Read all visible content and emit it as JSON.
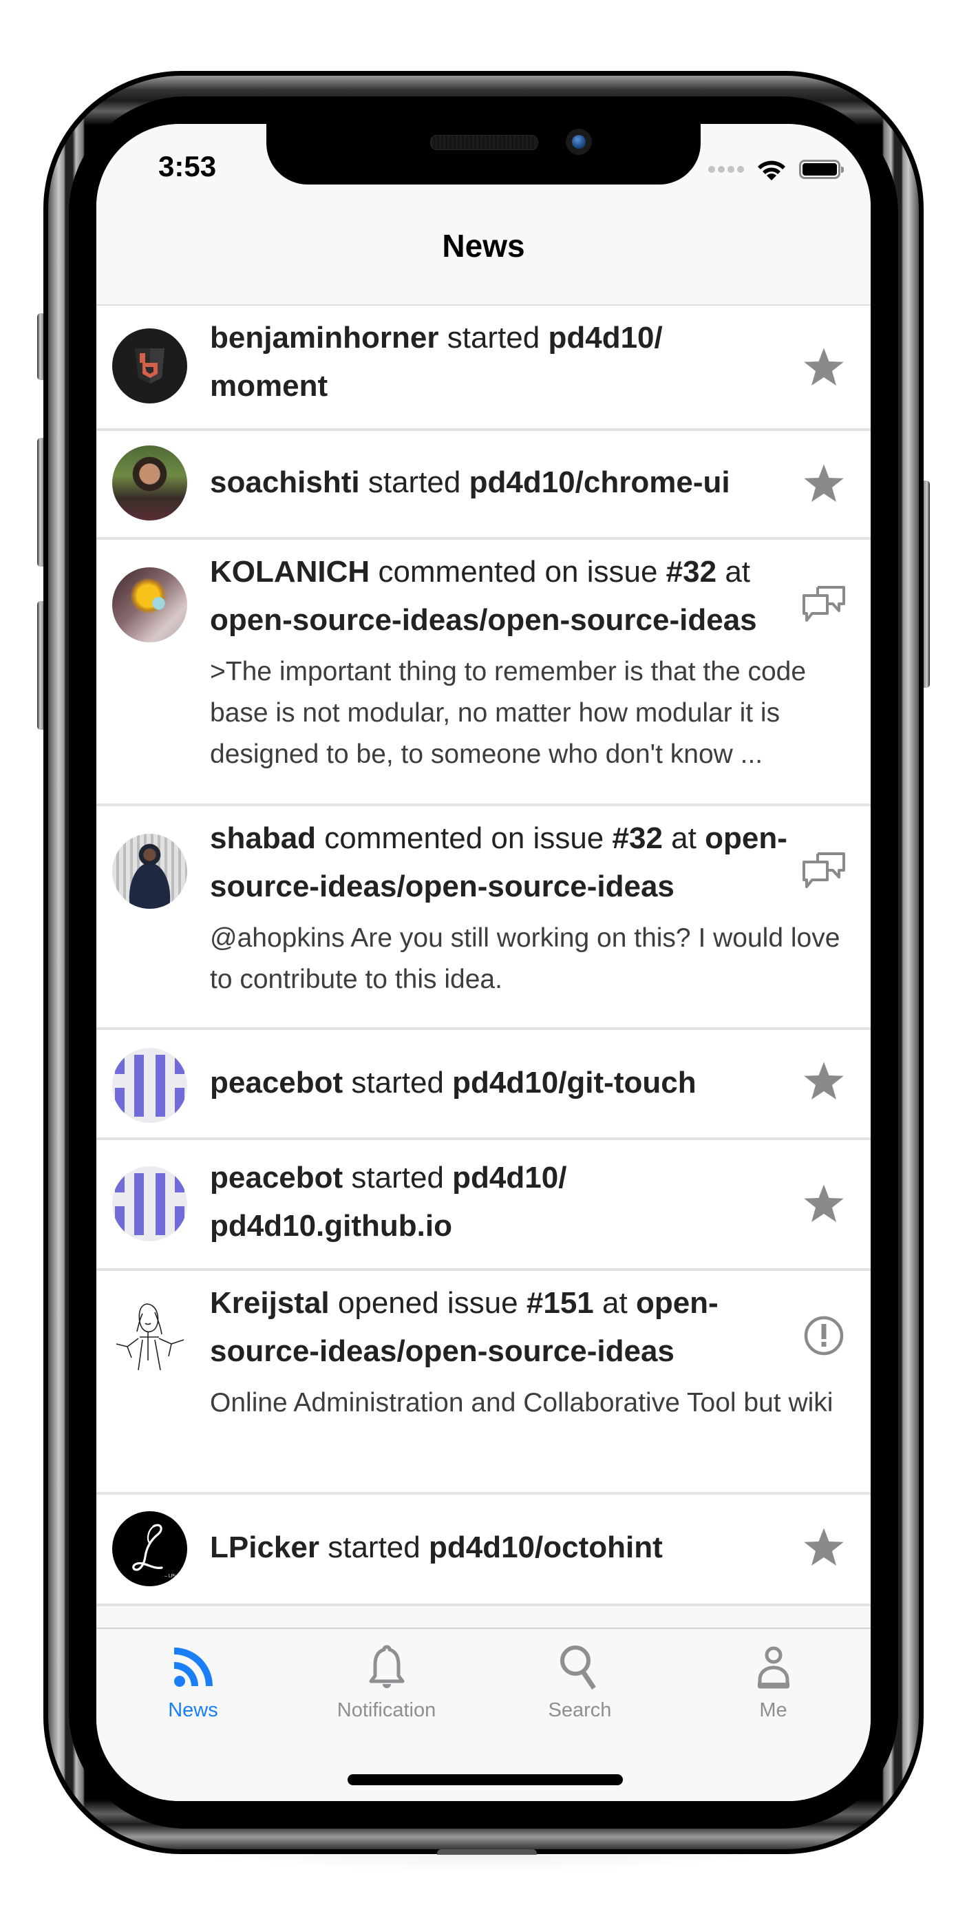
{
  "status_bar": {
    "time": "3:53",
    "signal_icon": "signal-dots-icon",
    "wifi_icon": "wifi-icon",
    "battery_icon": "battery-icon"
  },
  "nav": {
    "title": "News"
  },
  "colors": {
    "accent": "#1a7ef7",
    "icon_gray": "#8e8e93",
    "row_icon_gray": "#8a8a8a",
    "separator": "#e2e2e2",
    "peacebot_purple": "#6f6bd8"
  },
  "feed": [
    {
      "user": "benjaminhorner",
      "action": "started",
      "target": "pd4d10/",
      "target2": "moment",
      "body": "",
      "icon": "star-icon",
      "avatar": "benjaminhorner-avatar"
    },
    {
      "user": "soachishti",
      "action": "started",
      "target": "pd4d10/chrome-ui",
      "target2": "",
      "body": "",
      "icon": "star-icon",
      "avatar": "soachishti-avatar"
    },
    {
      "user": "KOLANICH",
      "action": "commented on issue",
      "issue": "#32",
      "at": "at",
      "target": "open-source-ideas/open-source-ideas",
      "body": ">The important thing to remember is that the code base is not modular, no matter how modular it is designed to be, to someone who don't know ...",
      "icon": "comment-discussion-icon",
      "avatar": "kolanich-avatar"
    },
    {
      "user": "shabad",
      "action": "commented on issue",
      "issue": "#32",
      "at": "at",
      "target": "open-source-ideas/open-source-ideas",
      "body": "@ahopkins Are you still working on this? I would love to contribute to this idea.",
      "icon": "comment-discussion-icon",
      "avatar": "shabad-avatar"
    },
    {
      "user": "peacebot",
      "action": "started",
      "target": "pd4d10/git-touch",
      "target2": "",
      "body": "",
      "icon": "star-icon",
      "avatar": "peacebot-avatar"
    },
    {
      "user": "peacebot",
      "action": "started",
      "target": "pd4d10/",
      "target2": "pd4d10.github.io",
      "body": "",
      "icon": "star-icon",
      "avatar": "peacebot-avatar"
    },
    {
      "user": "Kreijstal",
      "action": "opened issue",
      "issue": "#151",
      "at": "at",
      "target": "open-",
      "target2": "source-ideas/open-source-ideas",
      "body": "Online Administration and Collaborative Tool but wiki",
      "icon": "issue-opened-icon",
      "avatar": "kreijstal-avatar"
    },
    {
      "user": "LPicker",
      "action": "started",
      "target": "pd4d10/octohint",
      "target2": "",
      "body": "",
      "icon": "star-icon",
      "avatar": "lpicker-avatar"
    }
  ],
  "tabbar": {
    "tabs": [
      {
        "label": "News",
        "icon": "rss-icon",
        "active": true
      },
      {
        "label": "Notification",
        "icon": "bell-icon",
        "active": false
      },
      {
        "label": "Search",
        "icon": "search-icon",
        "active": false
      },
      {
        "label": "Me",
        "icon": "person-icon",
        "active": false
      }
    ]
  }
}
